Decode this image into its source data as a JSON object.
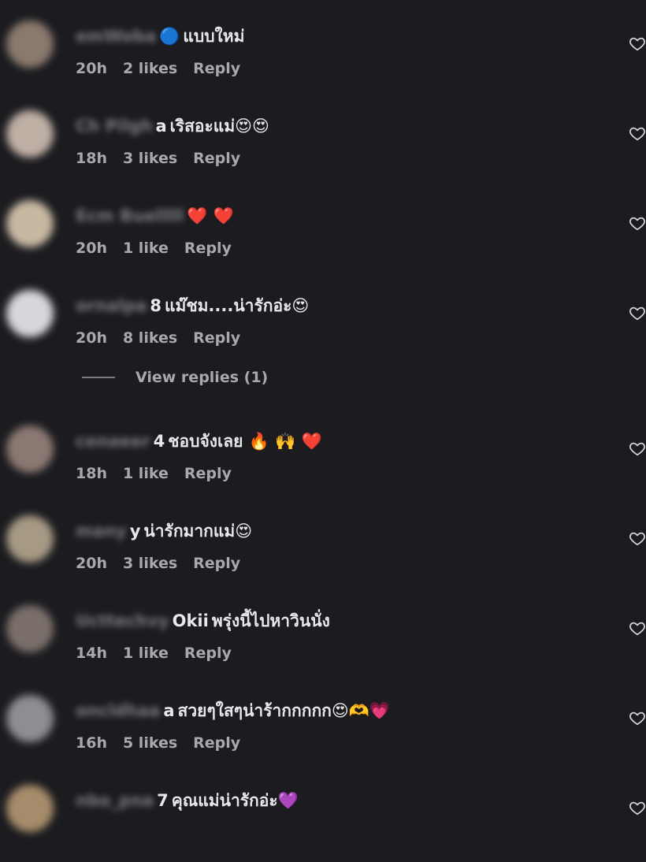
{
  "comments": [
    {
      "username": "emWoba",
      "username_tail": "",
      "text": "แบบใหม่",
      "time": "20h",
      "likes": "2 likes",
      "reply": "Reply",
      "avatar_color": "#8a7a6e",
      "emoji": "🔵"
    },
    {
      "username": "Ch Pilgh",
      "username_tail": "a",
      "text": "เริสอะแม่😍😍",
      "time": "18h",
      "likes": "3 likes",
      "reply": "Reply",
      "avatar_color": "#bfb0a5",
      "emoji": ""
    },
    {
      "username": "Ecm Buelllll",
      "username_tail": "",
      "text": "❤️ ❤️",
      "time": "20h",
      "likes": "1 like",
      "reply": "Reply",
      "avatar_color": "#c7b8a2",
      "emoji": ""
    },
    {
      "username": "ornalpa",
      "username_tail": "8",
      "text": "แม๊ชม....น่ารักอ่ะ😍",
      "time": "20h",
      "likes": "8 likes",
      "reply": "Reply",
      "avatar_color": "#d5d7dc",
      "emoji": ""
    },
    {
      "username": "cenaeer",
      "username_tail": "4",
      "text": "ชอบจังเลย 🔥 🙌 ❤️",
      "time": "18h",
      "likes": "1 like",
      "reply": "Reply",
      "avatar_color": "#8c7872",
      "emoji": ""
    },
    {
      "username": "many",
      "username_tail": "y",
      "text": "น่ารักมากแม่😍",
      "time": "20h",
      "likes": "3 likes",
      "reply": "Reply",
      "avatar_color": "#a69a84",
      "emoji": ""
    },
    {
      "username": "Ucttechvy",
      "username_tail": "Okii",
      "text": "พรุ่งนี้ไปหาวินนั่ง",
      "time": "14h",
      "likes": "1 like",
      "reply": "Reply",
      "avatar_color": "#7a6f6a",
      "emoji": ""
    },
    {
      "username": "oncldhaa",
      "username_tail": "a",
      "text": "สวยๆใสๆน่าร้ากกกกก😍🫶💗",
      "time": "16h",
      "likes": "5 likes",
      "reply": "Reply",
      "avatar_color": "#8e8e92",
      "emoji": ""
    },
    {
      "username": "nbo_pna",
      "username_tail": "7",
      "text": "คุณแม่น่ารักอ่ะ💜",
      "time": "",
      "likes": "",
      "reply": "",
      "avatar_color": "#a68c6a",
      "emoji": ""
    }
  ],
  "view_replies": "View replies (1)",
  "colors": {
    "background": "#1c1c20",
    "text": "#e8e8ea",
    "meta": "#a8a8ae"
  }
}
